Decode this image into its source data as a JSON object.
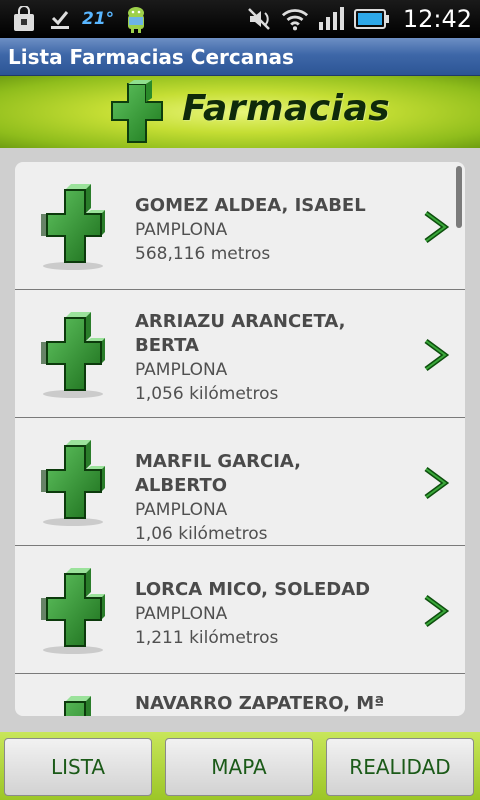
{
  "status_bar": {
    "temperature": "21°",
    "time": "12:42",
    "icons": [
      "shopping-bag-icon",
      "download-done-icon",
      "android-icon",
      "mute-icon",
      "wifi-icon",
      "signal-icon",
      "battery-icon"
    ]
  },
  "title_bar": {
    "title": "Lista Farmacias Cercanas"
  },
  "banner": {
    "text": "Farmacias",
    "logo_icon": "green-cross-icon"
  },
  "pharmacies": [
    {
      "name": "GOMEZ ALDEA, ISABEL",
      "city": "PAMPLONA",
      "distance": "568,116 metros"
    },
    {
      "name": "ARRIAZU ARANCETA, BERTA",
      "city": "PAMPLONA",
      "distance": "1,056 kilómetros"
    },
    {
      "name": "MARFIL GARCIA, ALBERTO",
      "city": "PAMPLONA",
      "distance": "1,06 kilómetros"
    },
    {
      "name": "LORCA MICO, SOLEDAD",
      "city": "PAMPLONA",
      "distance": "1,211 kilómetros"
    },
    {
      "name": "NAVARRO ZAPATERO, Mª",
      "city": "",
      "distance": ""
    }
  ],
  "bottom_tabs": {
    "lista": "LISTA",
    "mapa": "MAPA",
    "realidad": "REALIDAD"
  },
  "colors": {
    "accent_green": "#2e8b2e",
    "title_blue": "#3e67a8",
    "banner_lime": "#c5de34"
  }
}
